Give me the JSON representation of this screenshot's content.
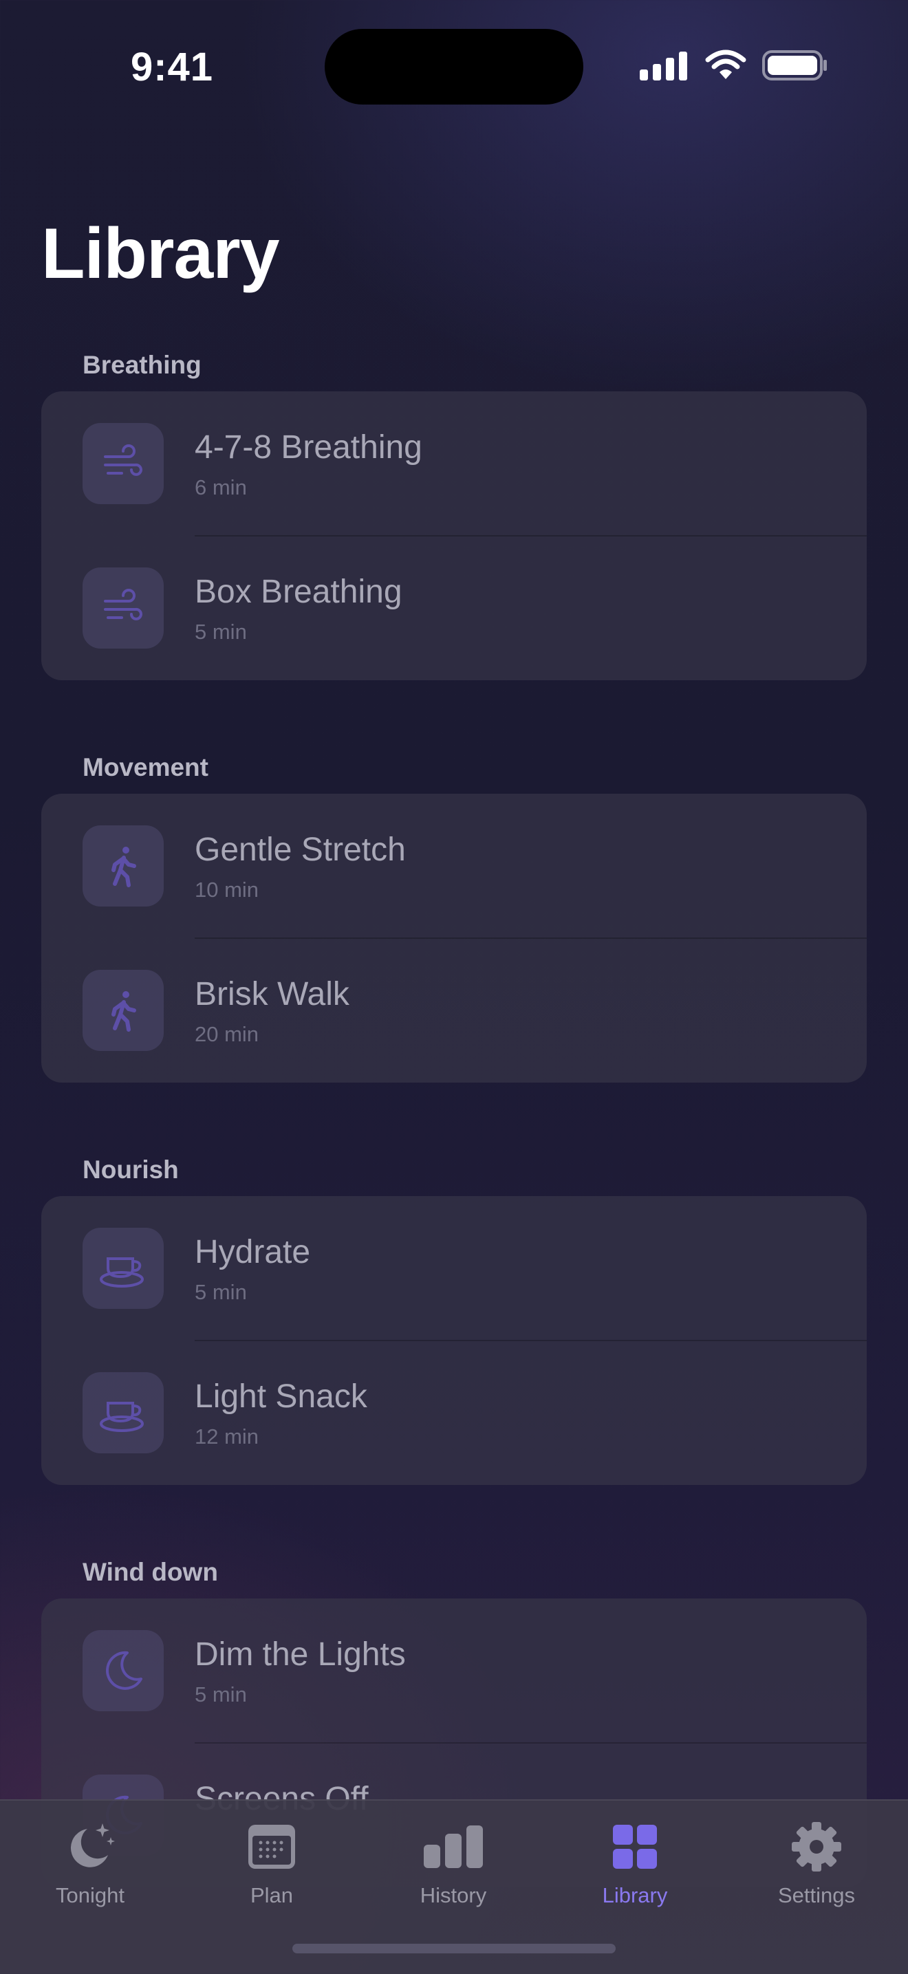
{
  "status_bar": {
    "time": "9:41"
  },
  "page": {
    "title": "Library"
  },
  "sections": [
    {
      "header": "Breathing",
      "icon": "wind-icon",
      "items": [
        {
          "title": "4-7-8 Breathing",
          "duration": "6 min"
        },
        {
          "title": "Box Breathing",
          "duration": "5 min"
        }
      ]
    },
    {
      "header": "Movement",
      "icon": "walking-figure-icon",
      "items": [
        {
          "title": "Gentle Stretch",
          "duration": "10 min"
        },
        {
          "title": "Brisk Walk",
          "duration": "20 min"
        }
      ]
    },
    {
      "header": "Nourish",
      "icon": "cup-saucer-icon",
      "items": [
        {
          "title": "Hydrate",
          "duration": "5 min"
        },
        {
          "title": "Light Snack",
          "duration": "12 min"
        }
      ]
    },
    {
      "header": "Wind down",
      "icon": "moon-icon",
      "items": [
        {
          "title": "Dim the Lights",
          "duration": "5 min"
        },
        {
          "title": "Screens Off",
          "duration": ""
        }
      ]
    }
  ],
  "tab_bar": {
    "tabs": [
      {
        "label": "Tonight",
        "icon": "moon-stars-icon"
      },
      {
        "label": "Plan",
        "icon": "calendar-icon"
      },
      {
        "label": "History",
        "icon": "bar-chart-icon"
      },
      {
        "label": "Library",
        "icon": "grid-icon"
      },
      {
        "label": "Settings",
        "icon": "gear-icon"
      }
    ],
    "active": "Library"
  },
  "colors": {
    "accent": "#8a79f0",
    "icon_tint": "#5d4fa8",
    "inactive": "#9a99a6"
  }
}
